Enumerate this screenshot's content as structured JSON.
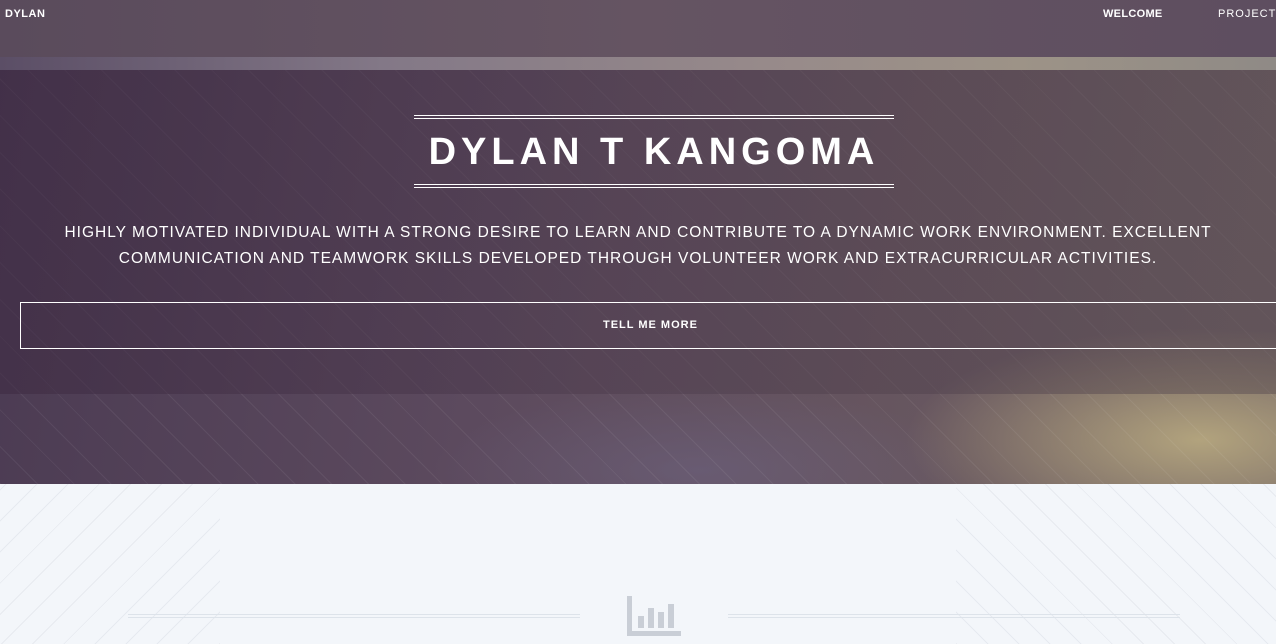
{
  "nav": {
    "brand": "DYLAN",
    "welcome": "WELCOME",
    "projects": "PROJECTS",
    "projects_icon": "chevron-down-icon"
  },
  "hero": {
    "title": "DYLAN T KANGOMA",
    "tagline_line1": "HIGHLY MOTIVATED INDIVIDUAL WITH A STRONG DESIRE TO LEARN AND CONTRIBUTE TO A DYNAMIC WORK ENVIRONMENT. EXCELLENT",
    "tagline_line2": "COMMUNICATION AND TEAMWORK SKILLS DEVELOPED THROUGH VOLUNTEER WORK AND EXTRACURRICULAR ACTIVITIES.",
    "cta_label": "TELL ME MORE"
  },
  "section2": {
    "icon": "bar-chart-icon"
  },
  "colors": {
    "hero_bg": "#5c4a5e",
    "section_bg": "#f3f6fa",
    "text_light": "#ffffff",
    "icon_gray": "#c9ced6"
  }
}
